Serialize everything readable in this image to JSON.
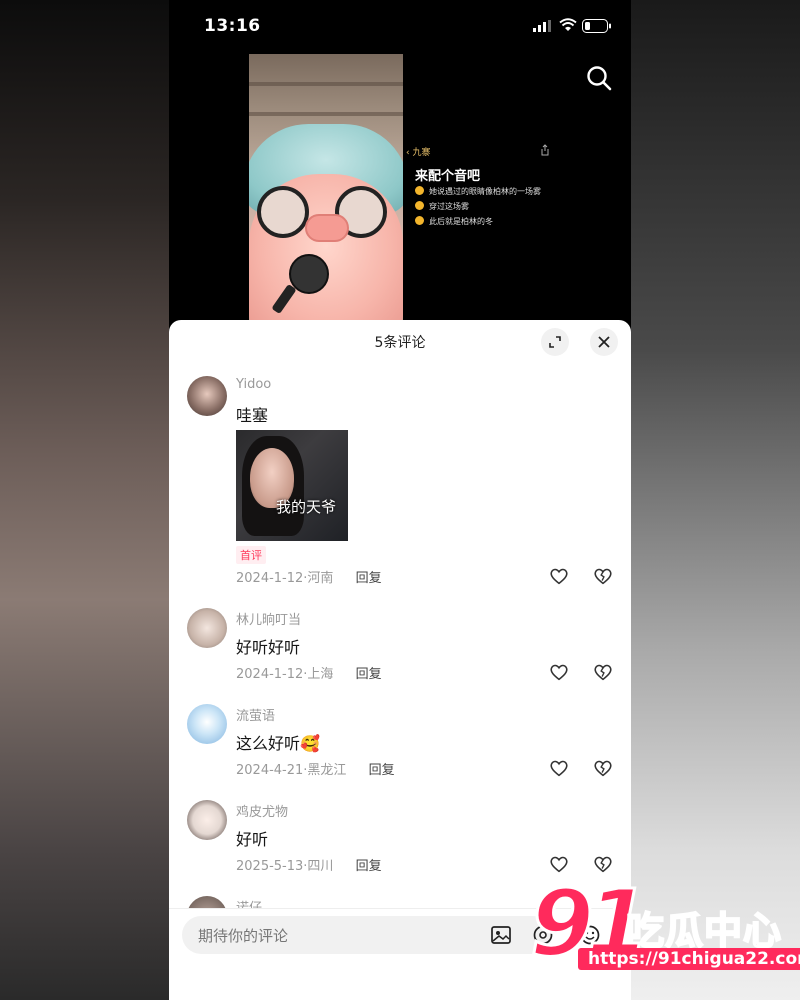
{
  "status_bar": {
    "time": "13:16"
  },
  "video": {
    "overlay": {
      "back_label": "九寨",
      "title": "来配个音吧",
      "items": [
        "她说遇过的眼睛像柏林的一场雾",
        "穿过这场雾",
        "此后就是柏林的冬"
      ]
    }
  },
  "comments_panel": {
    "title": "5条评论",
    "comments": [
      {
        "username": "Yidoo",
        "text": "哇塞",
        "sticker_text": "我的天爷",
        "badge": "首评",
        "date": "2024-1-12",
        "location": "河南",
        "reply_label": "回复",
        "avatar_color": "#8a6f66"
      },
      {
        "username": "林儿晌叮当",
        "text": "好听好听",
        "date": "2024-1-12",
        "location": "上海",
        "reply_label": "回复",
        "avatar_color": "#c7b3a8"
      },
      {
        "username": "流萤语",
        "text": "这么好听",
        "emoji": "🥰",
        "date": "2024-4-21",
        "location": "黑龙江",
        "reply_label": "回复",
        "avatar_color": "#9cc8ea"
      },
      {
        "username": "鸡皮尤物",
        "text": "好听",
        "date": "2025-5-13",
        "location": "四川",
        "reply_label": "回复",
        "avatar_color": "#e4d8d2"
      },
      {
        "username": "诺仔",
        "avatar_color": "#7a6a63"
      }
    ],
    "input": {
      "placeholder": "期待你的评论"
    }
  },
  "watermark": {
    "number": "91",
    "name": "吃瓜中心",
    "url": "https://91chigua22.com"
  },
  "colors": {
    "accent": "#ff2a5c",
    "badge_text": "#ff3b5c",
    "meta_gray": "#999999"
  }
}
